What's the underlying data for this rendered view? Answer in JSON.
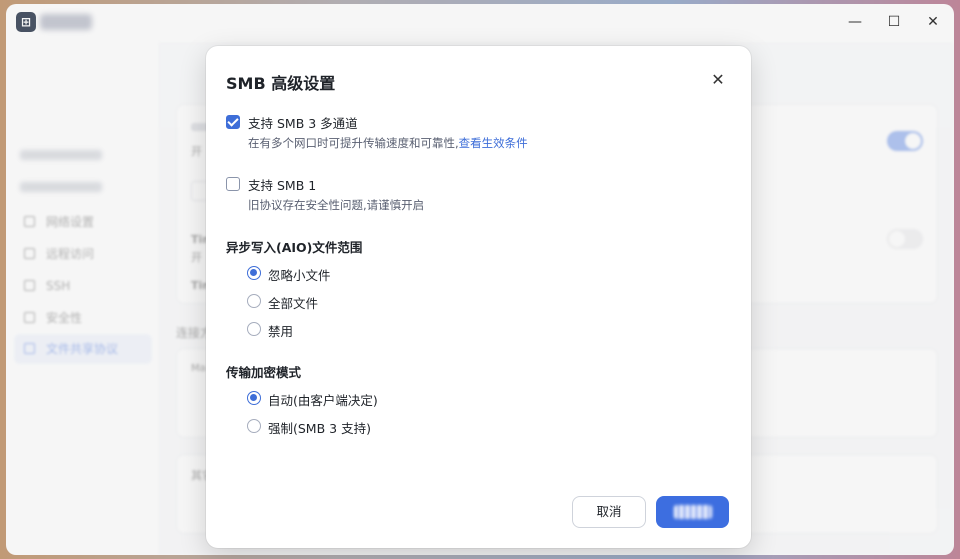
{
  "window": {
    "title_icon": "app-icon",
    "controls": {
      "minimize": "—",
      "maximize": "☐",
      "close": "✕"
    }
  },
  "background": {
    "sidebar": {
      "items": [
        {
          "label": "网络设置",
          "icon": "network-icon"
        },
        {
          "label": "远程访问",
          "icon": "send-icon"
        },
        {
          "label": "SSH",
          "icon": "terminal-icon"
        },
        {
          "label": "安全性",
          "icon": "shield-icon"
        },
        {
          "label": "文件共享协议",
          "icon": "document-icon",
          "active": true
        }
      ]
    },
    "main": {
      "row1_prefix": "开",
      "row2_prefix": "Tim",
      "row2_sub": "开",
      "row3_prefix": "Tim",
      "section_label": "连接方",
      "card_prefix": "Ma",
      "other_label": "其它",
      "toggle_states": [
        true,
        false
      ]
    }
  },
  "dialog": {
    "title": "SMB 高级设置",
    "close_icon": "close-icon",
    "multichannel": {
      "label": "支持 SMB 3 多通道",
      "checked": true,
      "desc": "在有多个网口时可提升传输速度和可靠性,",
      "link": "查看生效条件"
    },
    "smb1": {
      "label": "支持 SMB 1",
      "checked": false,
      "desc": "旧协议存在安全性问题,请谨慎开启"
    },
    "aio": {
      "title": "异步写入(AIO)文件范围",
      "options": [
        "忽略小文件",
        "全部文件",
        "禁用"
      ],
      "selected": 0
    },
    "encryption": {
      "title": "传输加密模式",
      "options": [
        "自动(由客户端决定)",
        "强制(SMB 3 支持)"
      ],
      "selected": 0
    },
    "buttons": {
      "cancel": "取消"
    },
    "colors": {
      "accent": "#3e6ed8",
      "primary_button": "#3d6ee0"
    }
  }
}
